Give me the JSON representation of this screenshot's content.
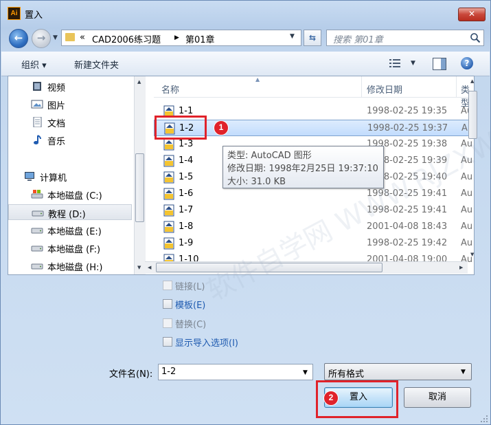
{
  "window": {
    "title": "置入",
    "app_icon_text": "Ai",
    "close_label": "✕"
  },
  "address": {
    "prefix": "«",
    "segments": [
      "CAD2006练习题",
      "第01章"
    ],
    "separator": "▶"
  },
  "search": {
    "placeholder": "搜索 第01章"
  },
  "toolbar": {
    "organize_label": "组织 ▾",
    "new_folder_label": "新建文件夹"
  },
  "nav": {
    "items": [
      {
        "label": "视频"
      },
      {
        "label": "图片"
      },
      {
        "label": "文档"
      },
      {
        "label": "音乐"
      },
      {
        "label": "计算机"
      },
      {
        "label": "本地磁盘 (C:)"
      },
      {
        "label": "教程 (D:)"
      },
      {
        "label": "本地磁盘 (E:)"
      },
      {
        "label": "本地磁盘 (F:)"
      },
      {
        "label": "本地磁盘 (H:)"
      }
    ]
  },
  "columns": {
    "name": "名称",
    "date": "修改日期",
    "type": "类型"
  },
  "files": [
    {
      "name": "1-1",
      "date": "1998-02-25 19:35",
      "type": "Au"
    },
    {
      "name": "1-2",
      "date": "1998-02-25 19:37",
      "type": "Au"
    },
    {
      "name": "1-3",
      "date": "1998-02-25 19:38",
      "type": "Au"
    },
    {
      "name": "1-4",
      "date": "1998-02-25 19:39",
      "type": "Au"
    },
    {
      "name": "1-5",
      "date": "1998-02-25 19:40",
      "type": "Au"
    },
    {
      "name": "1-6",
      "date": "1998-02-25 19:41",
      "type": "Au"
    },
    {
      "name": "1-7",
      "date": "1998-02-25 19:41",
      "type": "Au"
    },
    {
      "name": "1-8",
      "date": "2001-04-08 18:43",
      "type": "Au"
    },
    {
      "name": "1-9",
      "date": "1998-02-25 19:42",
      "type": "Au"
    },
    {
      "name": "1-10",
      "date": "2001-04-08 19:00",
      "type": "Au"
    }
  ],
  "tooltip": {
    "type_line": "类型: AutoCAD 图形",
    "date_line": "修改日期: 1998年2月25日 19:37:10",
    "size_line": "大小: 31.0 KB"
  },
  "options": {
    "link": "链接(L)",
    "template": "模板(E)",
    "replace": "替换(C)",
    "show_import": "显示导入选项(I)"
  },
  "filename": {
    "label": "文件名(N):",
    "value": "1-2"
  },
  "format": {
    "value": "所有格式"
  },
  "buttons": {
    "place": "置入",
    "cancel": "取消"
  },
  "annotations": {
    "badge1": "1",
    "badge2": "2"
  },
  "watermark": "软件自学网 WWW.RJZXW.COM",
  "colors": {
    "annotation_red": "#e0222a",
    "selection_blue": "#c2dcfd",
    "link_blue": "#1f5bb0"
  }
}
